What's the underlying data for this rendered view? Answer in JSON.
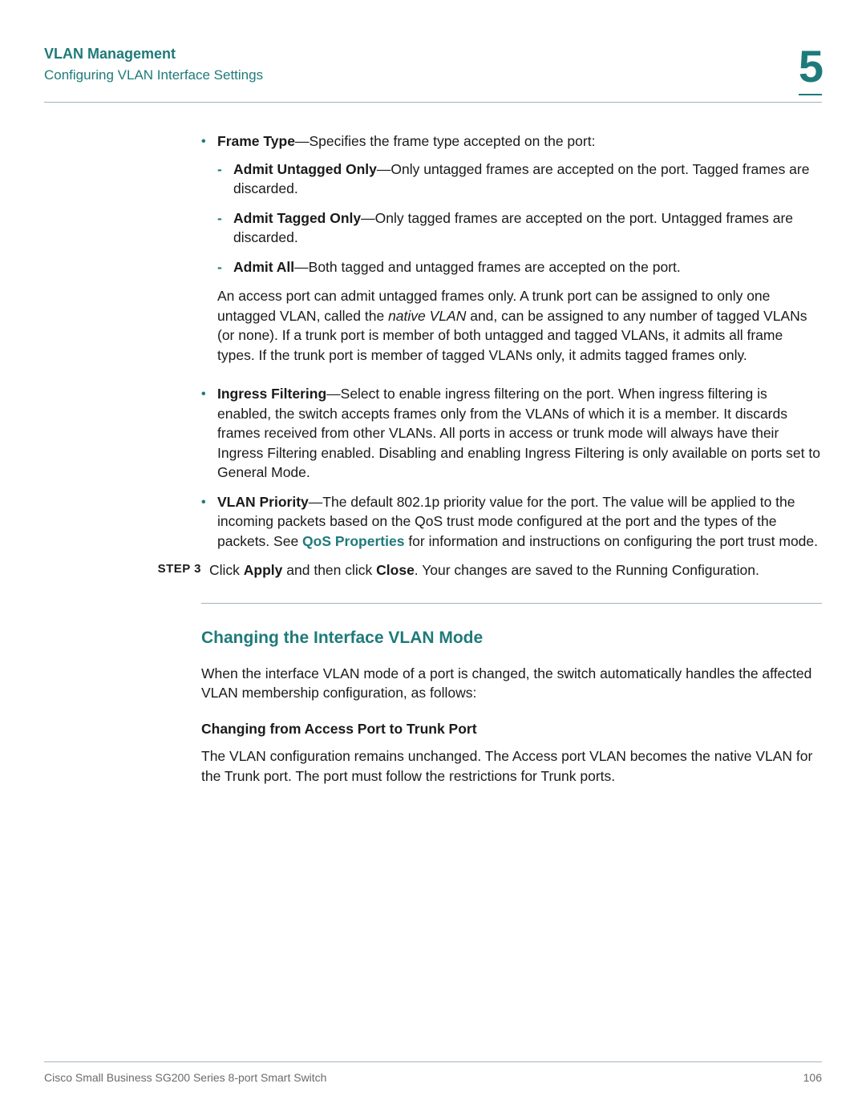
{
  "header": {
    "title": "VLAN Management",
    "subtitle": "Configuring VLAN Interface Settings",
    "chapter_number": "5"
  },
  "bullets": {
    "frame_type": {
      "term": "Frame Type",
      "desc": "—Specifies the frame type accepted on the port:",
      "items": [
        {
          "term": "Admit Untagged Only",
          "desc": "—Only untagged frames are accepted on the port. Tagged frames are discarded."
        },
        {
          "term": "Admit Tagged Only",
          "desc": "—Only tagged frames are accepted on the port. Untagged frames are discarded."
        },
        {
          "term": "Admit All",
          "desc": "—Both tagged and untagged frames are accepted on the port."
        }
      ],
      "note_pre": "An access port can admit untagged frames only. A trunk port can be assigned to only one untagged VLAN, called the ",
      "note_em": "native VLAN",
      "note_post": " and, can be assigned to any number of tagged VLANs (or none). If a trunk port is member of both untagged and tagged VLANs, it admits all frame types. If the trunk port is member of tagged VLANs only, it admits tagged frames only."
    },
    "ingress": {
      "term": "Ingress Filtering",
      "desc": "—Select to enable ingress filtering on the port. When ingress filtering is enabled, the switch accepts frames only from the VLANs of which it is a member. It discards frames received from other VLANs. All ports in access or trunk mode will always have their Ingress Filtering enabled. Disabling and enabling Ingress Filtering is only available on ports set to General Mode."
    },
    "priority": {
      "term": "VLAN Priority",
      "desc_pre": "—The default 802.1p priority value for the port. The value will be applied to the incoming packets based on the QoS trust mode configured at the port and the types of the packets. See ",
      "link": "QoS Properties",
      "desc_post": " for information and instructions on configuring the port trust mode."
    }
  },
  "step": {
    "label": "STEP  3",
    "pre": "Click ",
    "b1": "Apply",
    "mid": " and then click ",
    "b2": "Close",
    "post": ". Your changes are saved to the Running Configuration."
  },
  "section": {
    "heading": "Changing the Interface VLAN Mode",
    "intro": "When the interface VLAN mode of a port is changed, the switch automatically handles the affected VLAN membership configuration, as follows:",
    "sub_heading": "Changing from Access Port to Trunk Port",
    "sub_body": "The VLAN configuration remains unchanged. The Access port VLAN becomes the native VLAN for the Trunk port. The port must follow the restrictions for Trunk ports."
  },
  "footer": {
    "left": "Cisco Small Business SG200 Series 8-port Smart Switch",
    "right": "106"
  }
}
